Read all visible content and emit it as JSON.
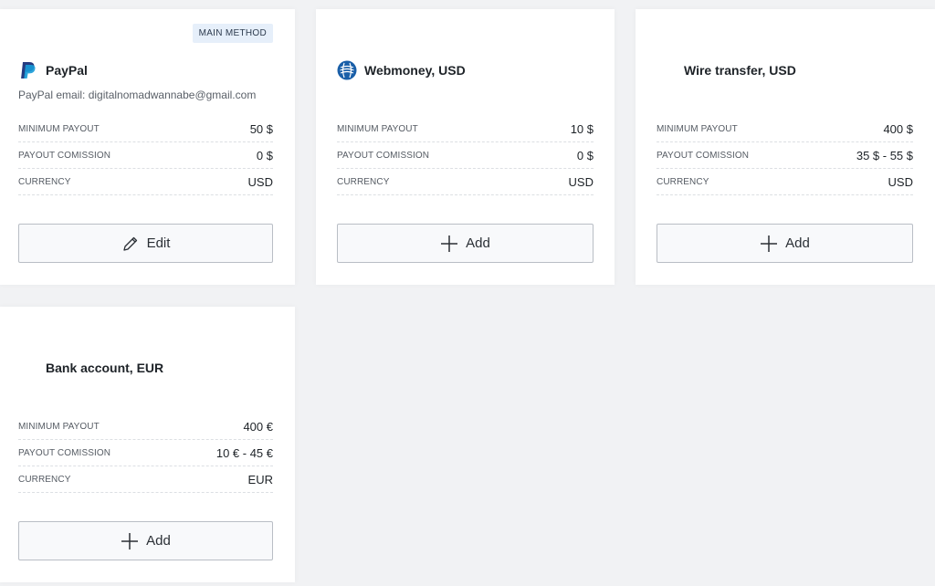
{
  "cards": [
    {
      "title": "PayPal",
      "logo": "paypal-logo",
      "badge": "MAIN METHOD",
      "subtitle": "PayPal email: digitalnomadwannabe@gmail.com",
      "rows": [
        {
          "label": "MINIMUM PAYOUT",
          "value": "50 $"
        },
        {
          "label": "PAYOUT COMISSION",
          "value": "0 $"
        },
        {
          "label": "CURRENCY",
          "value": "USD"
        }
      ],
      "button": {
        "label": "Edit",
        "icon": "pencil-icon"
      }
    },
    {
      "title": "Webmoney, USD",
      "logo": "webmoney-logo",
      "rows": [
        {
          "label": "MINIMUM PAYOUT",
          "value": "10 $"
        },
        {
          "label": "PAYOUT COMISSION",
          "value": "0 $"
        },
        {
          "label": "CURRENCY",
          "value": "USD"
        }
      ],
      "button": {
        "label": "Add",
        "icon": "plus-icon"
      }
    },
    {
      "title": "Wire transfer, USD",
      "rows": [
        {
          "label": "MINIMUM PAYOUT",
          "value": "400 $"
        },
        {
          "label": "PAYOUT COMISSION",
          "value": "35 $ - 55 $"
        },
        {
          "label": "CURRENCY",
          "value": "USD"
        }
      ],
      "button": {
        "label": "Add",
        "icon": "plus-icon"
      }
    },
    {
      "title": "Bank account, EUR",
      "rows": [
        {
          "label": "MINIMUM PAYOUT",
          "value": "400 €"
        },
        {
          "label": "PAYOUT COMISSION",
          "value": "10 € - 45 €"
        },
        {
          "label": "CURRENCY",
          "value": "EUR"
        }
      ],
      "button": {
        "label": "Add",
        "icon": "plus-icon"
      }
    }
  ],
  "colors": {
    "page_background": "#f1f2f4",
    "card_background": "#ffffff",
    "badge_background": "#e6effa",
    "paypal_dark_blue": "#253b80",
    "paypal_light_blue": "#179bd7",
    "webmoney_blue": "#1a5fa8"
  }
}
